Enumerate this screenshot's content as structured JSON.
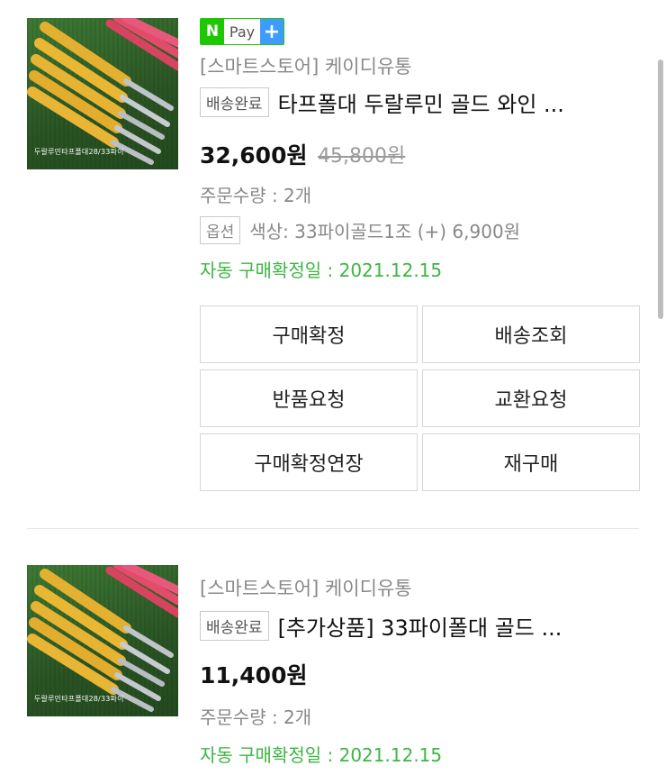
{
  "orders": [
    {
      "thumbnail_caption": "두랄루민타프폴대28/33파이",
      "pay_badge": {
        "n": "N",
        "label": "Pay",
        "plus": "+"
      },
      "store": "[스마트스토어] 케이디유통",
      "status": "배송완료",
      "title": "타프폴대 두랄루민 골드 와인 ...",
      "price": "32,600원",
      "original_price": "45,800원",
      "quantity": "주문수량 : 2개",
      "option_badge": "옵션",
      "option_text": "색상: 33파이골드1조 (+) 6,900원",
      "auto_confirm": "자동 구매확정일 : 2021.12.15",
      "buttons": [
        "구매확정",
        "배송조회",
        "반품요청",
        "교환요청",
        "구매확정연장",
        "재구매"
      ]
    },
    {
      "thumbnail_caption": "두랄루민타프폴대28/33파이",
      "store": "[스마트스토어] 케이디유통",
      "status": "배송완료",
      "title": "[추가상품] 33파이폴대 골드 ...",
      "price": "11,400원",
      "quantity": "주문수량 : 2개",
      "auto_confirm": "자동 구매확정일 : 2021.12.15"
    }
  ],
  "colors": {
    "npay_green": "#1ec800",
    "plus_blue": "#3e9bff",
    "confirm_green": "#3cb642"
  }
}
